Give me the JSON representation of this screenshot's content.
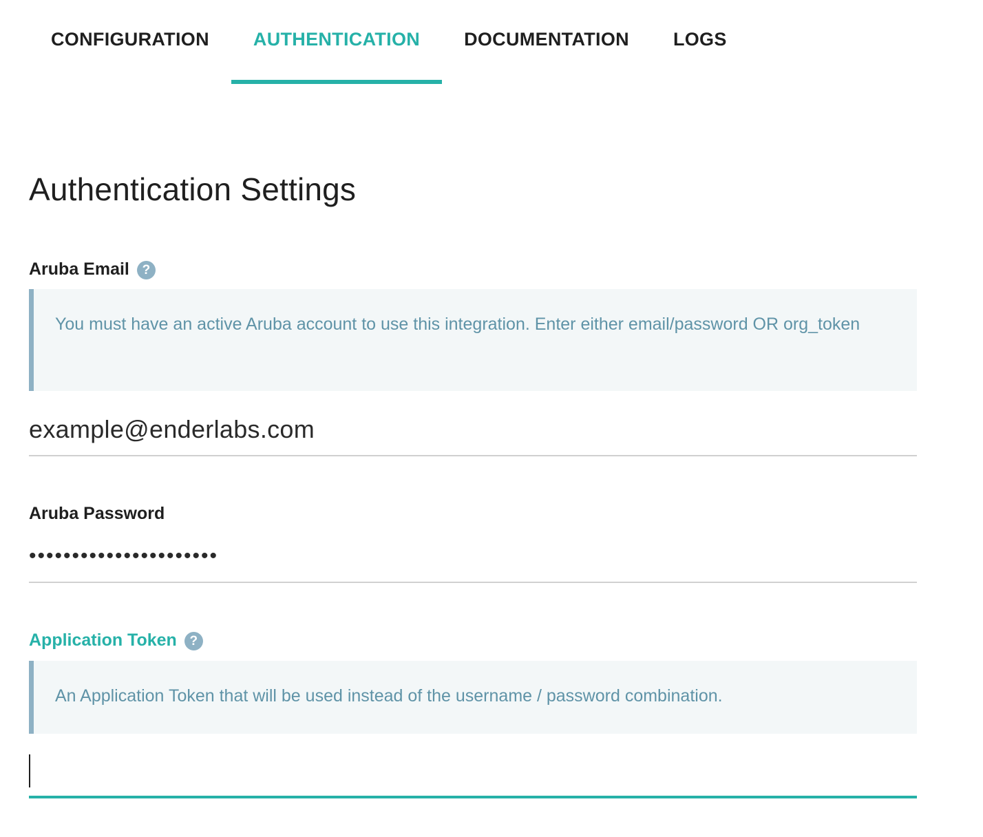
{
  "tabs": [
    {
      "label": "CONFIGURATION",
      "active": false
    },
    {
      "label": "AUTHENTICATION",
      "active": true
    },
    {
      "label": "DOCUMENTATION",
      "active": false
    },
    {
      "label": "LOGS",
      "active": false
    }
  ],
  "section": {
    "title": "Authentication Settings"
  },
  "fields": {
    "email": {
      "label": "Aruba Email",
      "help": "?",
      "hint": "You must have an active Aruba account to use this integration. Enter either email/password OR org_token",
      "value": "example@enderlabs.com"
    },
    "password": {
      "label": "Aruba Password",
      "value": "••••••••••••••••••••••"
    },
    "token": {
      "label": "Application Token",
      "help": "?",
      "hint": "An Application Token that will be used instead of the username / password combination.",
      "value": ""
    }
  },
  "colors": {
    "accent": "#26b1a8",
    "help_icon": "#8eb1c4",
    "hint_text": "#5f93a7",
    "hint_bg": "#f3f7f8"
  }
}
